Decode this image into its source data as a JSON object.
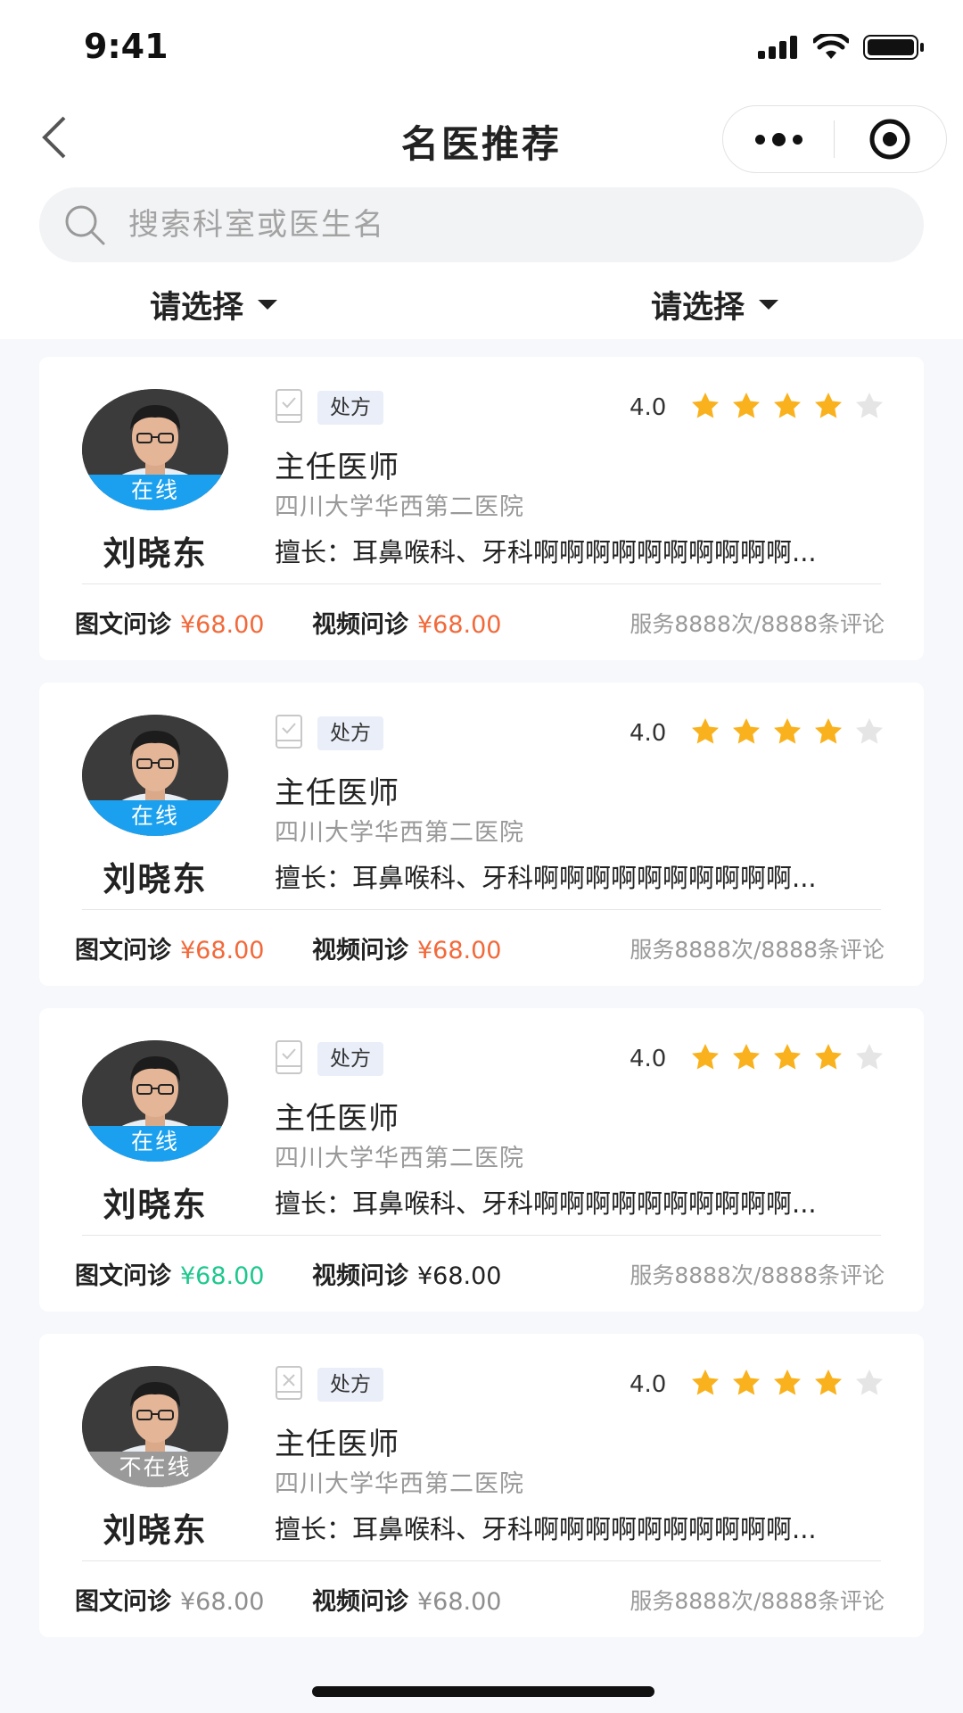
{
  "status_bar": {
    "time": "9:41"
  },
  "nav": {
    "title": "名医推荐"
  },
  "search": {
    "placeholder": "搜索科室或医生名"
  },
  "filters": [
    {
      "label": "请选择"
    },
    {
      "label": "请选择"
    }
  ],
  "colors": {
    "online": "#1aa0ef",
    "offline": "#9a9a9a",
    "price_orange": "#f2693a",
    "price_green": "#1ec88d",
    "price_dark": "#222222",
    "price_gray": "#8e8e8e",
    "star": "#f9b21d",
    "star_empty": "#e5e5e5"
  },
  "cards": [
    {
      "status": "在线",
      "name": "刘晓东",
      "rx_label": "处方",
      "rating": "4.0",
      "stars_filled": 4,
      "stars_total": 5,
      "title": "主任医师",
      "hospital": "四川大学华西第二医院",
      "specialty": "擅长：耳鼻喉科、牙科啊啊啊啊啊啊啊啊啊啊...",
      "consult1_label": "图文问诊",
      "consult1_price": "¥68.00",
      "consult2_label": "视频问诊",
      "consult2_price": "¥68.00",
      "stats": "服务8888次/8888条评论"
    },
    {
      "status": "在线",
      "name": "刘晓东",
      "rx_label": "处方",
      "rating": "4.0",
      "stars_filled": 4,
      "stars_total": 5,
      "title": "主任医师",
      "hospital": "四川大学华西第二医院",
      "specialty": "擅长：耳鼻喉科、牙科啊啊啊啊啊啊啊啊啊啊...",
      "consult1_label": "图文问诊",
      "consult1_price": "¥68.00",
      "consult2_label": "视频问诊",
      "consult2_price": "¥68.00",
      "stats": "服务8888次/8888条评论"
    },
    {
      "status": "在线",
      "name": "刘晓东",
      "rx_label": "处方",
      "rating": "4.0",
      "stars_filled": 4,
      "stars_total": 5,
      "title": "主任医师",
      "hospital": "四川大学华西第二医院",
      "specialty": "擅长：耳鼻喉科、牙科啊啊啊啊啊啊啊啊啊啊...",
      "consult1_label": "图文问诊",
      "consult1_price": "¥68.00",
      "consult2_label": "视频问诊",
      "consult2_price": "¥68.00",
      "stats": "服务8888次/8888条评论"
    },
    {
      "status": "不在线",
      "name": "刘晓东",
      "rx_label": "处方",
      "rating": "4.0",
      "stars_filled": 4,
      "stars_total": 5,
      "title": "主任医师",
      "hospital": "四川大学华西第二医院",
      "specialty": "擅长：耳鼻喉科、牙科啊啊啊啊啊啊啊啊啊啊...",
      "consult1_label": "图文问诊",
      "consult1_price": "¥68.00",
      "consult2_label": "视频问诊",
      "consult2_price": "¥68.00",
      "stats": "服务8888次/8888条评论"
    }
  ]
}
